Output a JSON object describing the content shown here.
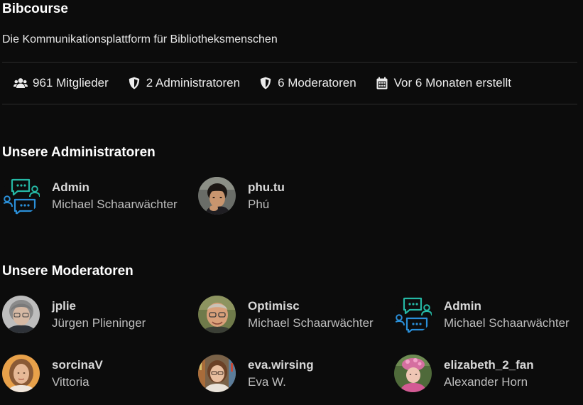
{
  "community": {
    "name": "Bibcourse",
    "description": "Die Kommunikationsplattform für Bibliotheksmenschen"
  },
  "stats": {
    "members": "961 Mitglieder",
    "admins": "2 Administratoren",
    "moderators": "6 Moderatoren",
    "created": "Vor 6 Monaten erstellt"
  },
  "admins_section": {
    "title": "Unsere Administratoren",
    "members": [
      {
        "username": "Admin",
        "fullname": "Michael Schaarwächter",
        "avatar": "chat-logo-icon"
      },
      {
        "username": "phu.tu",
        "fullname": "Phú",
        "avatar": "photo"
      }
    ]
  },
  "moderators_section": {
    "title": "Unsere Moderatoren",
    "members": [
      {
        "username": "jplie",
        "fullname": "Jürgen Plieninger",
        "avatar": "photo"
      },
      {
        "username": "Optimisc",
        "fullname": "Michael Schaarwächter",
        "avatar": "photo"
      },
      {
        "username": "Admin",
        "fullname": "Michael Schaarwächter",
        "avatar": "chat-logo-icon"
      },
      {
        "username": "sorcinaV",
        "fullname": "Vittoria",
        "avatar": "photo"
      },
      {
        "username": "eva.wirsing",
        "fullname": "Eva W.",
        "avatar": "photo"
      },
      {
        "username": "elizabeth_2_fan",
        "fullname": "Alexander Horn",
        "avatar": "photo"
      }
    ]
  },
  "colors": {
    "background": "#0c0c0c",
    "logo_teal": "#25b8a5",
    "logo_blue": "#2a8fd8"
  }
}
